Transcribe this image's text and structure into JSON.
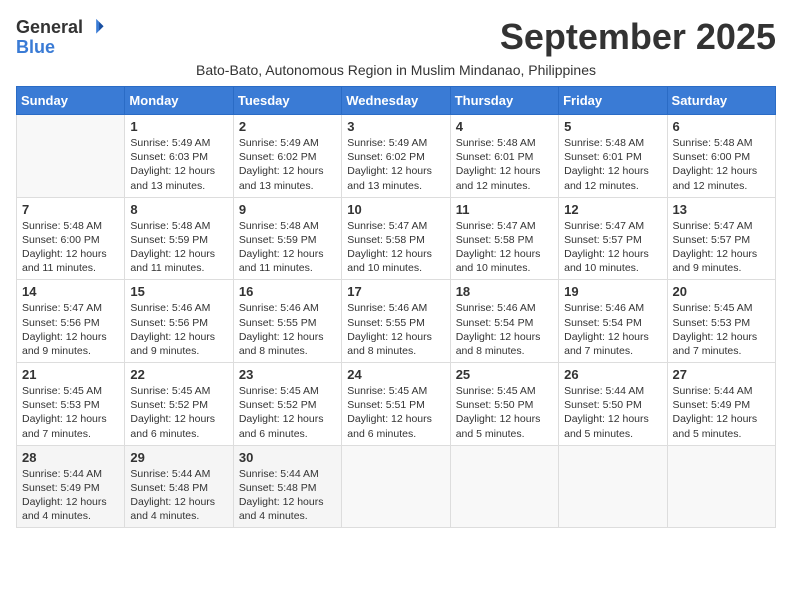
{
  "logo": {
    "general": "General",
    "blue": "Blue"
  },
  "title": "September 2025",
  "subtitle": "Bato-Bato, Autonomous Region in Muslim Mindanao, Philippines",
  "days": [
    "Sunday",
    "Monday",
    "Tuesday",
    "Wednesday",
    "Thursday",
    "Friday",
    "Saturday"
  ],
  "weeks": [
    [
      {
        "day": "",
        "info": ""
      },
      {
        "day": "1",
        "info": "Sunrise: 5:49 AM\nSunset: 6:03 PM\nDaylight: 12 hours\nand 13 minutes."
      },
      {
        "day": "2",
        "info": "Sunrise: 5:49 AM\nSunset: 6:02 PM\nDaylight: 12 hours\nand 13 minutes."
      },
      {
        "day": "3",
        "info": "Sunrise: 5:49 AM\nSunset: 6:02 PM\nDaylight: 12 hours\nand 13 minutes."
      },
      {
        "day": "4",
        "info": "Sunrise: 5:48 AM\nSunset: 6:01 PM\nDaylight: 12 hours\nand 12 minutes."
      },
      {
        "day": "5",
        "info": "Sunrise: 5:48 AM\nSunset: 6:01 PM\nDaylight: 12 hours\nand 12 minutes."
      },
      {
        "day": "6",
        "info": "Sunrise: 5:48 AM\nSunset: 6:00 PM\nDaylight: 12 hours\nand 12 minutes."
      }
    ],
    [
      {
        "day": "7",
        "info": "Sunrise: 5:48 AM\nSunset: 6:00 PM\nDaylight: 12 hours\nand 11 minutes."
      },
      {
        "day": "8",
        "info": "Sunrise: 5:48 AM\nSunset: 5:59 PM\nDaylight: 12 hours\nand 11 minutes."
      },
      {
        "day": "9",
        "info": "Sunrise: 5:48 AM\nSunset: 5:59 PM\nDaylight: 12 hours\nand 11 minutes."
      },
      {
        "day": "10",
        "info": "Sunrise: 5:47 AM\nSunset: 5:58 PM\nDaylight: 12 hours\nand 10 minutes."
      },
      {
        "day": "11",
        "info": "Sunrise: 5:47 AM\nSunset: 5:58 PM\nDaylight: 12 hours\nand 10 minutes."
      },
      {
        "day": "12",
        "info": "Sunrise: 5:47 AM\nSunset: 5:57 PM\nDaylight: 12 hours\nand 10 minutes."
      },
      {
        "day": "13",
        "info": "Sunrise: 5:47 AM\nSunset: 5:57 PM\nDaylight: 12 hours\nand 9 minutes."
      }
    ],
    [
      {
        "day": "14",
        "info": "Sunrise: 5:47 AM\nSunset: 5:56 PM\nDaylight: 12 hours\nand 9 minutes."
      },
      {
        "day": "15",
        "info": "Sunrise: 5:46 AM\nSunset: 5:56 PM\nDaylight: 12 hours\nand 9 minutes."
      },
      {
        "day": "16",
        "info": "Sunrise: 5:46 AM\nSunset: 5:55 PM\nDaylight: 12 hours\nand 8 minutes."
      },
      {
        "day": "17",
        "info": "Sunrise: 5:46 AM\nSunset: 5:55 PM\nDaylight: 12 hours\nand 8 minutes."
      },
      {
        "day": "18",
        "info": "Sunrise: 5:46 AM\nSunset: 5:54 PM\nDaylight: 12 hours\nand 8 minutes."
      },
      {
        "day": "19",
        "info": "Sunrise: 5:46 AM\nSunset: 5:54 PM\nDaylight: 12 hours\nand 7 minutes."
      },
      {
        "day": "20",
        "info": "Sunrise: 5:45 AM\nSunset: 5:53 PM\nDaylight: 12 hours\nand 7 minutes."
      }
    ],
    [
      {
        "day": "21",
        "info": "Sunrise: 5:45 AM\nSunset: 5:53 PM\nDaylight: 12 hours\nand 7 minutes."
      },
      {
        "day": "22",
        "info": "Sunrise: 5:45 AM\nSunset: 5:52 PM\nDaylight: 12 hours\nand 6 minutes."
      },
      {
        "day": "23",
        "info": "Sunrise: 5:45 AM\nSunset: 5:52 PM\nDaylight: 12 hours\nand 6 minutes."
      },
      {
        "day": "24",
        "info": "Sunrise: 5:45 AM\nSunset: 5:51 PM\nDaylight: 12 hours\nand 6 minutes."
      },
      {
        "day": "25",
        "info": "Sunrise: 5:45 AM\nSunset: 5:50 PM\nDaylight: 12 hours\nand 5 minutes."
      },
      {
        "day": "26",
        "info": "Sunrise: 5:44 AM\nSunset: 5:50 PM\nDaylight: 12 hours\nand 5 minutes."
      },
      {
        "day": "27",
        "info": "Sunrise: 5:44 AM\nSunset: 5:49 PM\nDaylight: 12 hours\nand 5 minutes."
      }
    ],
    [
      {
        "day": "28",
        "info": "Sunrise: 5:44 AM\nSunset: 5:49 PM\nDaylight: 12 hours\nand 4 minutes."
      },
      {
        "day": "29",
        "info": "Sunrise: 5:44 AM\nSunset: 5:48 PM\nDaylight: 12 hours\nand 4 minutes."
      },
      {
        "day": "30",
        "info": "Sunrise: 5:44 AM\nSunset: 5:48 PM\nDaylight: 12 hours\nand 4 minutes."
      },
      {
        "day": "",
        "info": ""
      },
      {
        "day": "",
        "info": ""
      },
      {
        "day": "",
        "info": ""
      },
      {
        "day": "",
        "info": ""
      }
    ]
  ]
}
